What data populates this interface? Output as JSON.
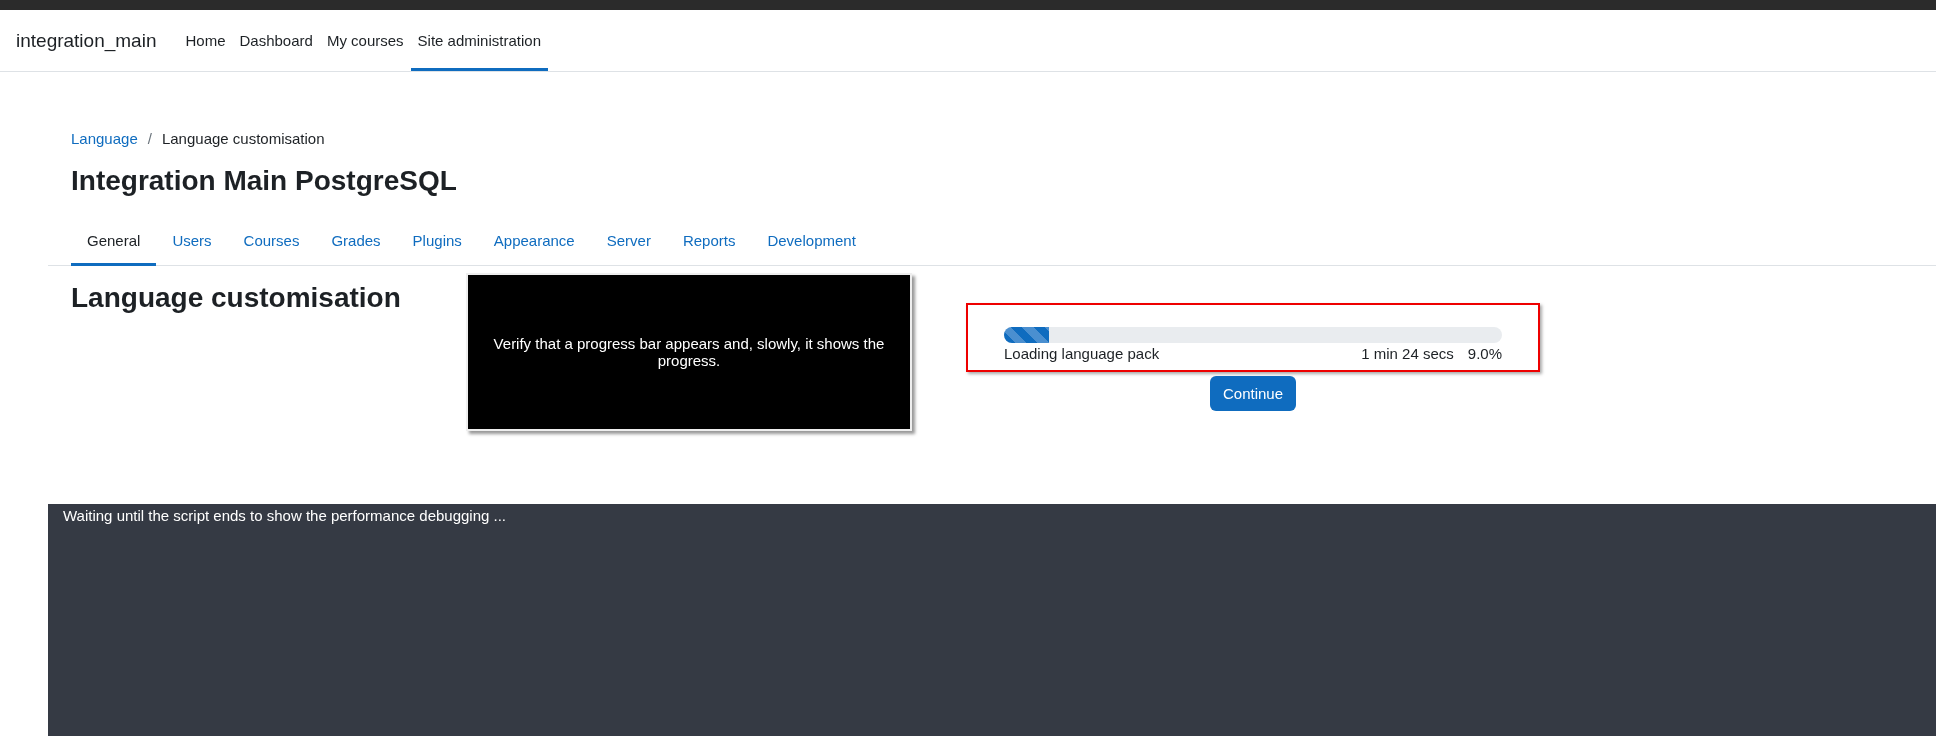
{
  "navbar": {
    "brand": "integration_main",
    "items": [
      {
        "label": "Home",
        "selected": false
      },
      {
        "label": "Dashboard",
        "selected": false
      },
      {
        "label": "My courses",
        "selected": false
      },
      {
        "label": "Site administration",
        "selected": true
      }
    ]
  },
  "breadcrumb": [
    {
      "label": "Language",
      "kind": "link"
    },
    {
      "label": "Language customisation",
      "kind": "current"
    }
  ],
  "breadcrumb_separator": "/",
  "page_title": "Integration Main PostgreSQL",
  "tabs": [
    {
      "label": "General",
      "selected": true
    },
    {
      "label": "Users",
      "selected": false
    },
    {
      "label": "Courses",
      "selected": false
    },
    {
      "label": "Grades",
      "selected": false
    },
    {
      "label": "Plugins",
      "selected": false
    },
    {
      "label": "Appearance",
      "selected": false
    },
    {
      "label": "Server",
      "selected": false
    },
    {
      "label": "Reports",
      "selected": false
    },
    {
      "label": "Development",
      "selected": false
    }
  ],
  "heading": "Language customisation",
  "instruction_overlay": "Verify that a progress bar appears and, slowly, it shows the progress.",
  "progress": {
    "level": 0.09,
    "label": "Loading language pack",
    "time": "1 min 24 secs",
    "percent": "9.0%"
  },
  "continue_button": "Continue",
  "debug_footer": "Waiting until the script ends to show the performance debugging ..."
}
